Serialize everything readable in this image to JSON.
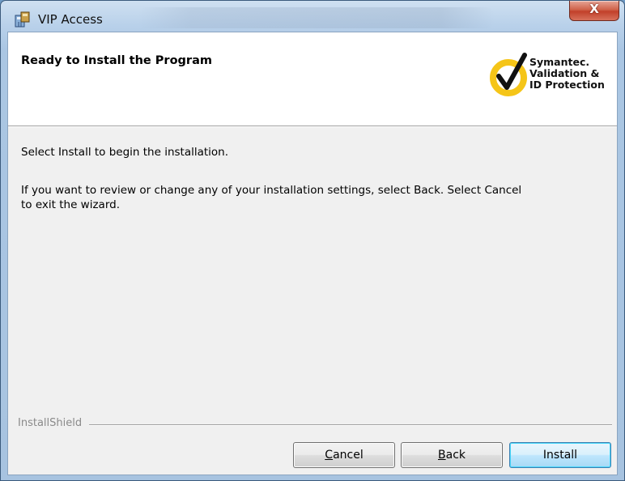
{
  "window": {
    "title": "VIP Access",
    "close_glyph": "X"
  },
  "header": {
    "title": "Ready to Install the Program",
    "logo": {
      "line1": "Symantec.",
      "line2": "Validation &",
      "line3": "ID Protection",
      "check_color": "#f5c518"
    }
  },
  "body": {
    "line1": "Select Install to begin the installation.",
    "line2a": "If you want to review or change any of your installation settings, select Back. Select Cancel",
    "line2b": "to exit the wizard."
  },
  "footer": {
    "brand": "InstallShield",
    "buttons": {
      "cancel_first": "C",
      "cancel_rest": "ancel",
      "back_first": "B",
      "back_rest": "ack",
      "install": "Install"
    }
  },
  "icons": {
    "app": "installer-icon",
    "logo": "symantec-checkmark-icon",
    "close": "close-icon"
  }
}
